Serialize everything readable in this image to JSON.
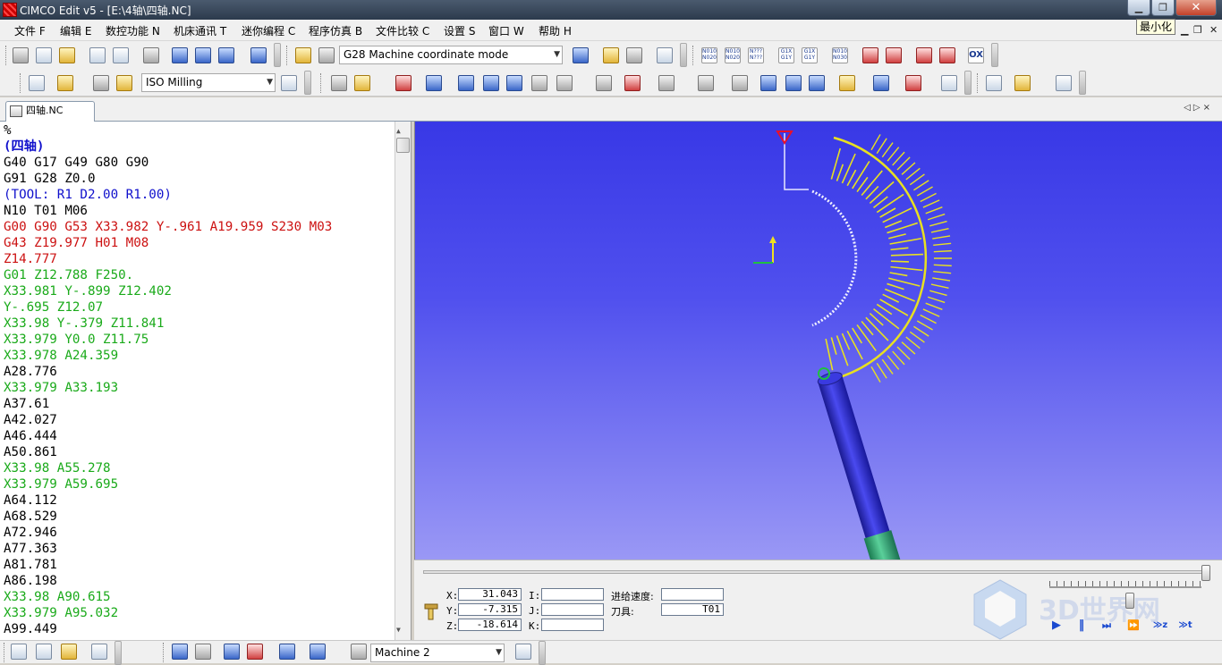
{
  "window": {
    "title": "CIMCO Edit v5 - [E:\\4轴\\四轴.NC]",
    "tooltip": "最小化",
    "min_glyph": "▁",
    "max_glyph": "❐",
    "close_glyph": "✕"
  },
  "menu": {
    "items": [
      "文件 F",
      "编辑 E",
      "数控功能 N",
      "机床通讯 T",
      "迷你编程 C",
      "程序仿真 B",
      "文件比较 C",
      "设置 S",
      "窗口 W",
      "帮助 H"
    ],
    "mdi_buttons": [
      "▁",
      "❐",
      "✕"
    ]
  },
  "toolbar": {
    "mode_combo": "G28 Machine coordinate mode",
    "machine_type_combo": "ISO Milling",
    "text_icons": [
      "N010\nN020",
      "N010\nN020",
      "N???\nN???",
      "G1X\nG1Y",
      "G1X\nG1Y",
      "N010\nN030"
    ],
    "ox_label": "OX"
  },
  "tab": {
    "file_name": "四轴.NC",
    "nav": "◁▷×"
  },
  "editor": {
    "lines": [
      {
        "text": "%",
        "c": "k"
      },
      {
        "text": "(四轴)",
        "c": "h"
      },
      {
        "text": "G40 G17 G49 G80 G90",
        "c": "k"
      },
      {
        "text": "G91 G28 Z0.0",
        "c": "k"
      },
      {
        "text": "(TOOL: R1 D2.00 R1.00)",
        "c": "c"
      },
      {
        "text": "N10 T01 M06",
        "c": "k"
      },
      {
        "text": "G00 G90 G53 X33.982 Y-.961 A19.959 S230 M03",
        "c": "r"
      },
      {
        "text": "G43 Z19.977 H01 M08",
        "c": "r"
      },
      {
        "text": "Z14.777",
        "c": "r"
      },
      {
        "text": "G01 Z12.788 F250.",
        "c": "g"
      },
      {
        "text": "X33.981 Y-.899 Z12.402",
        "c": "g"
      },
      {
        "text": "Y-.695 Z12.07",
        "c": "g"
      },
      {
        "text": "X33.98 Y-.379 Z11.841",
        "c": "g"
      },
      {
        "text": "X33.979 Y0.0 Z11.75",
        "c": "g"
      },
      {
        "text": "X33.978 A24.359",
        "c": "g"
      },
      {
        "text": "A28.776",
        "c": "k"
      },
      {
        "text": "X33.979 A33.193",
        "c": "g"
      },
      {
        "text": "A37.61",
        "c": "k"
      },
      {
        "text": "A42.027",
        "c": "k"
      },
      {
        "text": "A46.444",
        "c": "k"
      },
      {
        "text": "A50.861",
        "c": "k"
      },
      {
        "text": "X33.98 A55.278",
        "c": "g"
      },
      {
        "text": "X33.979 A59.695",
        "c": "g"
      },
      {
        "text": "A64.112",
        "c": "k"
      },
      {
        "text": "A68.529",
        "c": "k"
      },
      {
        "text": "A72.946",
        "c": "k"
      },
      {
        "text": "A77.363",
        "c": "k"
      },
      {
        "text": "A81.781",
        "c": "k"
      },
      {
        "text": "A86.198",
        "c": "k"
      },
      {
        "text": "X33.98 A90.615",
        "c": "g"
      },
      {
        "text": "X33.979 A95.032",
        "c": "g"
      },
      {
        "text": "A99.449",
        "c": "k"
      }
    ]
  },
  "simulation": {
    "x_label": "X:",
    "x_value": "31.043",
    "y_label": "Y:",
    "y_value": "-7.315",
    "z_label": "Z:",
    "z_value": "-18.614",
    "i_label": "I:",
    "i_value": "",
    "j_label": "J:",
    "j_value": "",
    "k_label": "K:",
    "k_value": "",
    "feed_label": "进给速度:",
    "feed_value": "",
    "tool_label": "刀具:",
    "tool_value": "T01",
    "progress_fraction": 1.0,
    "speed_fraction": 0.53,
    "play_glyph": "▶",
    "pause_glyph": "‖",
    "step_glyphs": [
      "⏭",
      "⏩",
      "≫z",
      "≫t"
    ]
  },
  "watermark": {
    "text": "3D世界网"
  },
  "statusbar": {
    "machine_combo": "Machine 2"
  },
  "colors": {
    "viewport_top": "#3838e6",
    "viewport_bottom": "#9a98f5",
    "toolpath": "#e8e020",
    "tool_shaft": "#2a2ad0",
    "holder": "#3ab07a"
  }
}
